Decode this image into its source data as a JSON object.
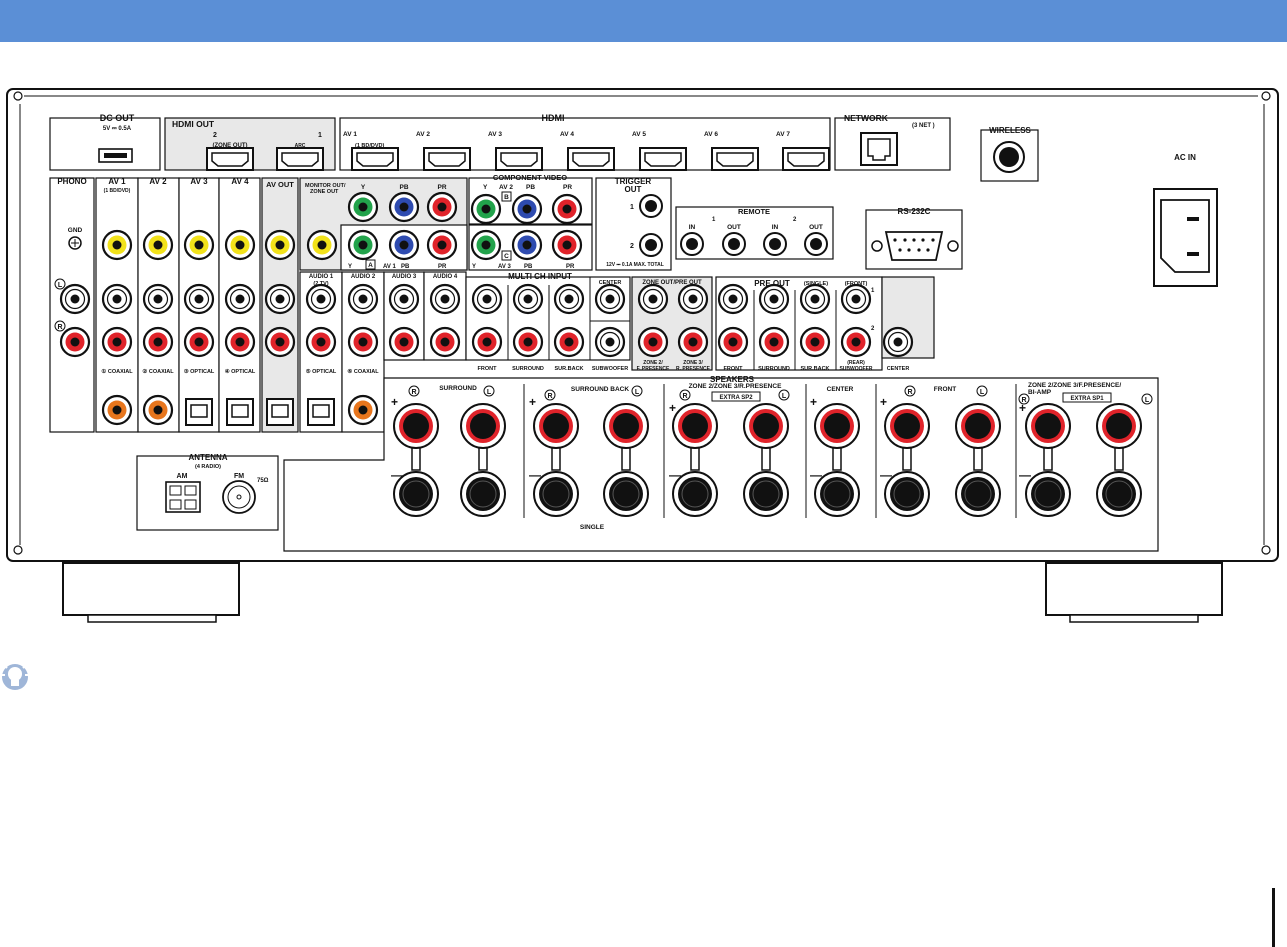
{
  "header": {
    "bar_color": "#5b8fd6"
  },
  "dc_out": {
    "title": "DC OUT",
    "rating": "5V ⎓ 0.5A"
  },
  "hdmi_out": {
    "title": "HDMI OUT",
    "num2": "2",
    "num1": "1",
    "zone_out": "(ZONE OUT)",
    "arc": "ARC"
  },
  "hdmi": {
    "title": "HDMI",
    "inputs": [
      "AV 1",
      "AV 2",
      "AV 3",
      "AV 4",
      "AV 5",
      "AV 6",
      "AV 7"
    ],
    "av1_sub": "(1 BD/DVD)"
  },
  "network": {
    "title": "NETWORK",
    "sub": "(3 NET )"
  },
  "wireless": {
    "title": "WIRELESS"
  },
  "ac_in": {
    "title": "AC IN"
  },
  "phono": {
    "title": "PHONO",
    "gnd": "GND",
    "l": "L",
    "r": "R"
  },
  "av_inputs": {
    "labels": [
      "AV 1",
      "AV 2",
      "AV 3",
      "AV 4"
    ],
    "av1_sub": "(1 BD/DVD)",
    "digital": [
      "① COAXIAL",
      "② COAXIAL",
      "③ OPTICAL",
      "④ OPTICAL"
    ]
  },
  "av_out": {
    "title": "AV OUT"
  },
  "monitor_out": {
    "title": "MONITOR OUT/",
    "sub": "ZONE OUT",
    "y": "Y",
    "pb": "PB",
    "pr": "PR"
  },
  "component": {
    "title": "COMPONENT VIDEO",
    "row1": [
      "Y",
      "AV 2",
      "PB",
      "PR"
    ],
    "b": "B",
    "a_row": [
      "Y",
      "A",
      "AV 1",
      "PB",
      "PR"
    ],
    "c_row": [
      "Y",
      "C",
      "AV 3",
      "PB",
      "PR"
    ]
  },
  "trigger": {
    "title": "TRIGGER",
    "sub": "OUT",
    "n1": "1",
    "n2": "2",
    "rating": "12V ⎓ 0.1A MAX. TOTAL"
  },
  "remote": {
    "title": "REMOTE",
    "n1": "1",
    "n2": "2",
    "labels": [
      "IN",
      "OUT",
      "IN",
      "OUT"
    ]
  },
  "rs232": {
    "title": "RS-232C"
  },
  "audio": {
    "labels": [
      "AUDIO 1",
      "AUDIO 2",
      "AUDIO 3",
      "AUDIO 4"
    ],
    "audio1_sub": "(2 TV)",
    "digital": [
      "⑤ OPTICAL",
      "⑥ COAXIAL"
    ]
  },
  "multi_ch": {
    "title": "MULTI CH INPUT",
    "labels": [
      "FRONT",
      "SURROUND",
      "SUR.BACK",
      "CENTER",
      "SUBWOOFER"
    ]
  },
  "zone_out": {
    "title": "ZONE OUT/PRE OUT",
    "labels": [
      "ZONE 2/",
      "F. PRESENCE",
      "ZONE 3/",
      "R. PRESENCE"
    ]
  },
  "pre_out": {
    "title": "PRE OUT",
    "single": "(SINGLE)",
    "front": "(FRONT)",
    "n1": "1",
    "n2": "2",
    "rear": "(REAR)",
    "labels": [
      "FRONT",
      "SURROUND",
      "SUR.BACK",
      "SUBWOOFER",
      "CENTER"
    ]
  },
  "antenna": {
    "title": "ANTENNA",
    "sub": "(4 RADIO)",
    "am": "AM",
    "fm": "FM",
    "ohm": "75Ω"
  },
  "speakers": {
    "title": "SPEAKERS",
    "groups": [
      "SURROUND",
      "SURROUND BACK",
      "ZONE 2/ZONE 3/R.PRESENCE",
      "CENTER",
      "FRONT",
      "ZONE 2/ZONE 3/F.PRESENCE/",
      "BI-AMP"
    ],
    "extra_sp2": "EXTRA SP2",
    "extra_sp1": "EXTRA SP1",
    "single": "SINGLE",
    "plus": "+",
    "minus": "—",
    "r": "R",
    "l": "L"
  },
  "colors": {
    "yellow": "#f2e21a",
    "red": "#e0232a",
    "green": "#22a34b",
    "blue": "#2e4bb0",
    "orange": "#e8761d",
    "panel": "#e8e8e8"
  }
}
